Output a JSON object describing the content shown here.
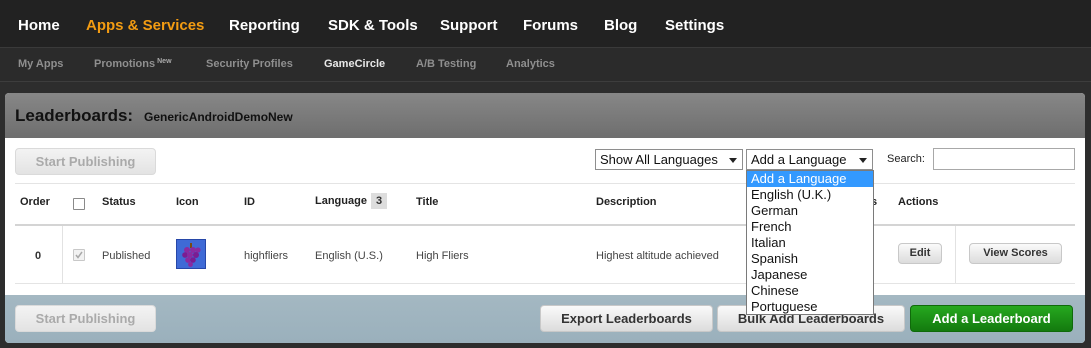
{
  "topnav": {
    "items": [
      "Home",
      "Apps & Services",
      "Reporting",
      "SDK & Tools",
      "Support",
      "Forums",
      "Blog",
      "Settings"
    ],
    "active": "Apps & Services"
  },
  "subnav": {
    "items": [
      "My Apps",
      "Promotions",
      "Security Profiles",
      "GameCircle",
      "A/B Testing",
      "Analytics"
    ],
    "promotions_badge": "New",
    "active": "GameCircle"
  },
  "header": {
    "title": "Leaderboards:",
    "app_name": "GenericAndroidDemoNew"
  },
  "toolbar": {
    "start_publishing": "Start Publishing",
    "language_filter": "Show All Languages",
    "add_language": "Add a Language",
    "search_label": "Search:",
    "search_value": ""
  },
  "table": {
    "headers": {
      "order": "Order",
      "status": "Status",
      "icon": "Icon",
      "id": "ID",
      "language": "Language",
      "language_count": "3",
      "title": "Title",
      "description": "Description",
      "partial": "s",
      "actions": "Actions"
    },
    "rows": [
      {
        "order": "0",
        "status": "Published",
        "icon": "grapes-icon",
        "id": "highfliers",
        "language": "English (U.S.)",
        "title": "High Fliers",
        "description": "Highest altitude achieved",
        "edit": "Edit",
        "view_scores": "View Scores"
      }
    ]
  },
  "language_dropdown": {
    "options": [
      "Add a Language",
      "English (U.K.)",
      "German",
      "French",
      "Italian",
      "Spanish",
      "Japanese",
      "Chinese",
      "Portuguese"
    ],
    "highlighted": "Add a Language"
  },
  "footer": {
    "start_publishing": "Start Publishing",
    "export": "Export Leaderboards",
    "bulk_add": "Bulk Add Leaderboards",
    "add_leaderboard": "Add a Leaderboard"
  },
  "colors": {
    "active_nav": "#f39c12",
    "add_button": "#1a8f14",
    "dropdown_highlight": "#3399ff"
  }
}
